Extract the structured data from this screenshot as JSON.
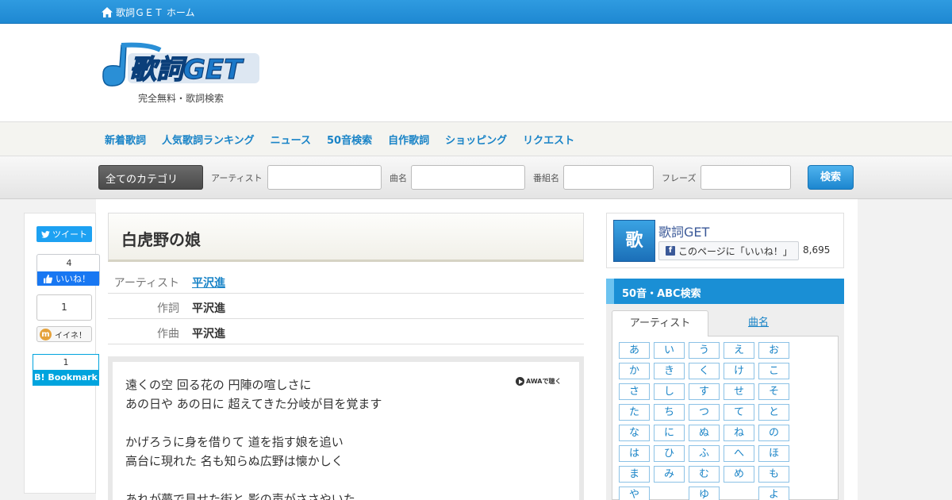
{
  "topbar": {
    "home_label": "歌詞ＧＥＴ ホーム"
  },
  "header": {
    "logo_text": "歌詞GET",
    "tagline": "完全無料・歌詞検索"
  },
  "nav": {
    "items": [
      "新着歌詞",
      "人気歌詞ランキング",
      "ニュース",
      "50音検索",
      "自作歌詞",
      "ショッピング",
      "リクエスト"
    ]
  },
  "search": {
    "category": "全てのカテゴリ",
    "artist_label": "アーティスト",
    "song_label": "曲名",
    "program_label": "番組名",
    "phrase_label": "フレーズ",
    "button": "検索"
  },
  "share": {
    "tweet": "ツイート",
    "fb_count": "4",
    "fb_like": "いいね！",
    "mixi_count": "1",
    "mixi_label": "イイネ！",
    "hatena_count": "1",
    "hatena_label": "Bookmark"
  },
  "song": {
    "title": "白虎野の娘",
    "rows": [
      {
        "key": "アーティスト",
        "value": "平沢進"
      },
      {
        "key": "作詞",
        "value": "平沢進"
      },
      {
        "key": "作曲",
        "value": "平沢進"
      }
    ],
    "awa_label": "AWAで聴く",
    "lyrics": [
      "遠くの空 回る花の 円陣の喧しさに",
      "あの日や あの日に 超えてきた分岐が目を覚ます",
      "かげろうに身を借りて 道を指す娘を追い",
      "高台に現れた 名も知らぬ広野は懐かしく",
      "あれが夢で見せた街と 影の声がささやいた"
    ]
  },
  "fbpage": {
    "name": "歌詞GET",
    "icon_text": "歌",
    "like_label": "このページに「いいね！」",
    "count": "8,695"
  },
  "kana_search": {
    "heading": "50音・ABC検索",
    "tab_artist": "アーティスト",
    "tab_song": "曲名",
    "rows": [
      [
        "あ",
        "い",
        "う",
        "え",
        "お"
      ],
      [
        "か",
        "き",
        "く",
        "け",
        "こ"
      ],
      [
        "さ",
        "し",
        "す",
        "せ",
        "そ"
      ],
      [
        "た",
        "ち",
        "つ",
        "て",
        "と"
      ],
      [
        "な",
        "に",
        "ぬ",
        "ね",
        "の"
      ],
      [
        "は",
        "ひ",
        "ふ",
        "へ",
        "ほ"
      ],
      [
        "ま",
        "み",
        "む",
        "め",
        "も"
      ],
      [
        "や",
        "",
        "ゆ",
        "",
        "よ"
      ]
    ]
  },
  "colors": {
    "brand_blue": "#1a84c7",
    "topbar": "#2f9be0",
    "facebook": "#3b5998"
  }
}
